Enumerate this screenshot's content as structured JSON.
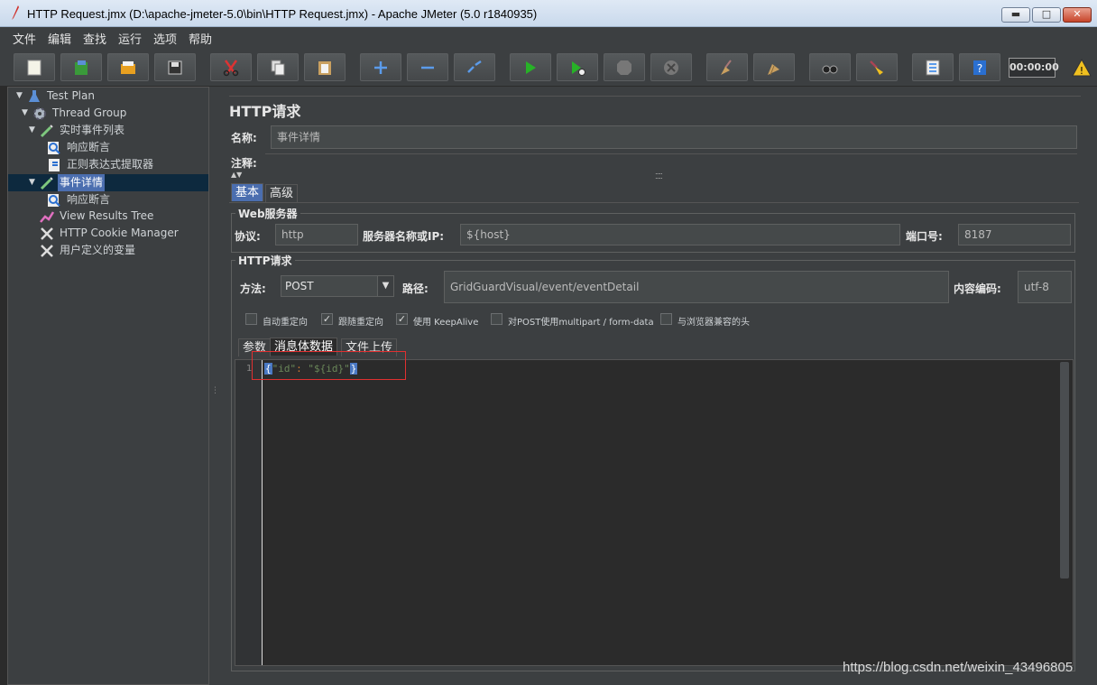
{
  "window": {
    "title": "HTTP Request.jmx (D:\\apache-jmeter-5.0\\bin\\HTTP Request.jmx) - Apache JMeter (5.0 r1840935)",
    "min": "▬",
    "max": "□",
    "close": "✕"
  },
  "menu": [
    "文件",
    "编辑",
    "查找",
    "运行",
    "选项",
    "帮助"
  ],
  "toolbar": {
    "timer": "00:00:00"
  },
  "tree": [
    {
      "label": "Test Plan",
      "icon": "flask-icon",
      "toggle": "▼"
    },
    {
      "label": "Thread Group",
      "icon": "gear-icon",
      "toggle": "▼"
    },
    {
      "label": "实时事件列表",
      "icon": "pipette-icon",
      "toggle": "▼"
    },
    {
      "label": "响应断言",
      "icon": "magnifier-icon",
      "toggle": ""
    },
    {
      "label": "正则表达式提取器",
      "icon": "extractor-icon",
      "toggle": ""
    },
    {
      "label": "事件详情",
      "icon": "pipette-icon",
      "toggle": "▼"
    },
    {
      "label": "响应断言",
      "icon": "magnifier-icon",
      "toggle": ""
    },
    {
      "label": "View Results Tree",
      "icon": "chart-icon",
      "toggle": ""
    },
    {
      "label": "HTTP Cookie Manager",
      "icon": "tools-icon",
      "toggle": ""
    },
    {
      "label": "用户定义的变量",
      "icon": "tools-icon",
      "toggle": ""
    }
  ],
  "panel": {
    "title": "HTTP请求",
    "name_label": "名称:",
    "name_value": "事件详情",
    "comment_label": "注释:",
    "tabs": [
      "基本",
      "高级"
    ],
    "web_server": {
      "title": "Web服务器",
      "protocol_label": "协议:",
      "protocol_value": "http",
      "server_label": "服务器名称或IP:",
      "server_value": "${host}",
      "port_label": "端口号:",
      "port_value": "8187"
    },
    "http_request": {
      "title": "HTTP请求",
      "method_label": "方法:",
      "method_value": "POST",
      "path_label": "路径:",
      "path_value": "GridGuardVisual/event/eventDetail",
      "encoding_label": "内容编码:",
      "encoding_value": "utf-8"
    },
    "checkboxes": [
      {
        "label": "自动重定向",
        "checked": false
      },
      {
        "label": "跟随重定向",
        "checked": true
      },
      {
        "label": "使用 KeepAlive",
        "checked": true
      },
      {
        "label": "对POST使用multipart / form-data",
        "checked": false
      },
      {
        "label": "与浏览器兼容的头",
        "checked": false
      }
    ],
    "body_tabs": [
      "参数",
      "消息体数据",
      "文件上传"
    ],
    "editor": {
      "line_number": "1",
      "open_brace": "{",
      "key": "\"id\"",
      "colon": ": ",
      "value": "\"${id}\"",
      "close_brace": "}"
    }
  },
  "watermark": "https://blog.csdn.net/weixin_43496805"
}
